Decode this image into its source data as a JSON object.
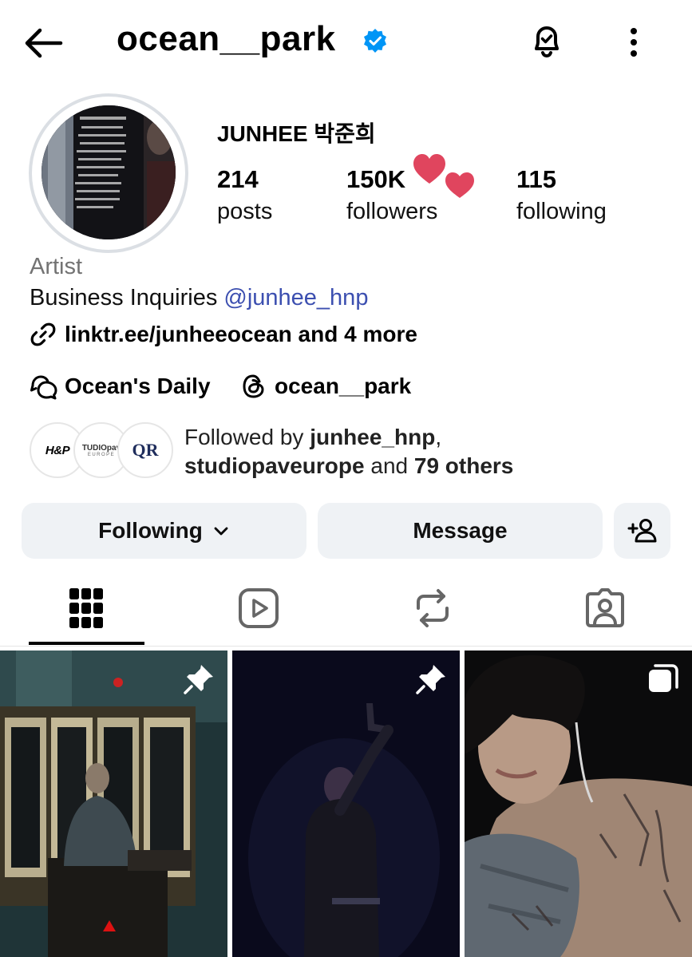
{
  "header": {
    "username": "ocean__park",
    "verified": true,
    "icons": {
      "back": "arrow-left-icon",
      "notifications": "bell-check-icon",
      "more": "more-vertical-icon"
    }
  },
  "profile": {
    "display_name": "JUNHEE 박준희",
    "stats": [
      {
        "value": "214",
        "label": "posts"
      },
      {
        "value": "150K",
        "label": "followers"
      },
      {
        "value": "115",
        "label": "following"
      }
    ],
    "category": "Artist",
    "bio_text": "Business Inquiries ",
    "bio_mention": "@junhee_hnp",
    "link_text": "linktr.ee/junheeocean and 4 more",
    "chips": [
      {
        "label": "Ocean's Daily",
        "icon": "chat-bubbles-icon"
      },
      {
        "label": "ocean__park",
        "icon": "threads-icon"
      }
    ]
  },
  "mutual_followers": {
    "avatars": [
      {
        "text": "H&P"
      },
      {
        "text": "TUDIOpav",
        "subtext": "EUROPE"
      },
      {
        "text": "QR"
      }
    ],
    "prefix": "Followed by ",
    "name1": "junhee_hnp",
    "sep": ",",
    "name2": "studiopaveurope",
    "and": " and ",
    "others": "79 others"
  },
  "actions": {
    "following_label": "Following",
    "message_label": "Message",
    "add_user_icon": "add-person-icon"
  },
  "tabs": [
    {
      "name": "grid",
      "icon": "grid-icon",
      "active": true
    },
    {
      "name": "reels",
      "icon": "reels-icon",
      "active": false
    },
    {
      "name": "reposts",
      "icon": "repost-icon",
      "active": false
    },
    {
      "name": "tagged",
      "icon": "tagged-icon",
      "active": false
    }
  ],
  "posts": [
    {
      "badge": "pin-icon"
    },
    {
      "badge": "pin-icon"
    },
    {
      "badge": "carousel-icon"
    }
  ],
  "colors": {
    "verified": "#0095f6",
    "mention": "#3c4fb0",
    "button_bg": "#eff2f5",
    "secondary_text": "#737373",
    "heart": "#e0455e"
  }
}
